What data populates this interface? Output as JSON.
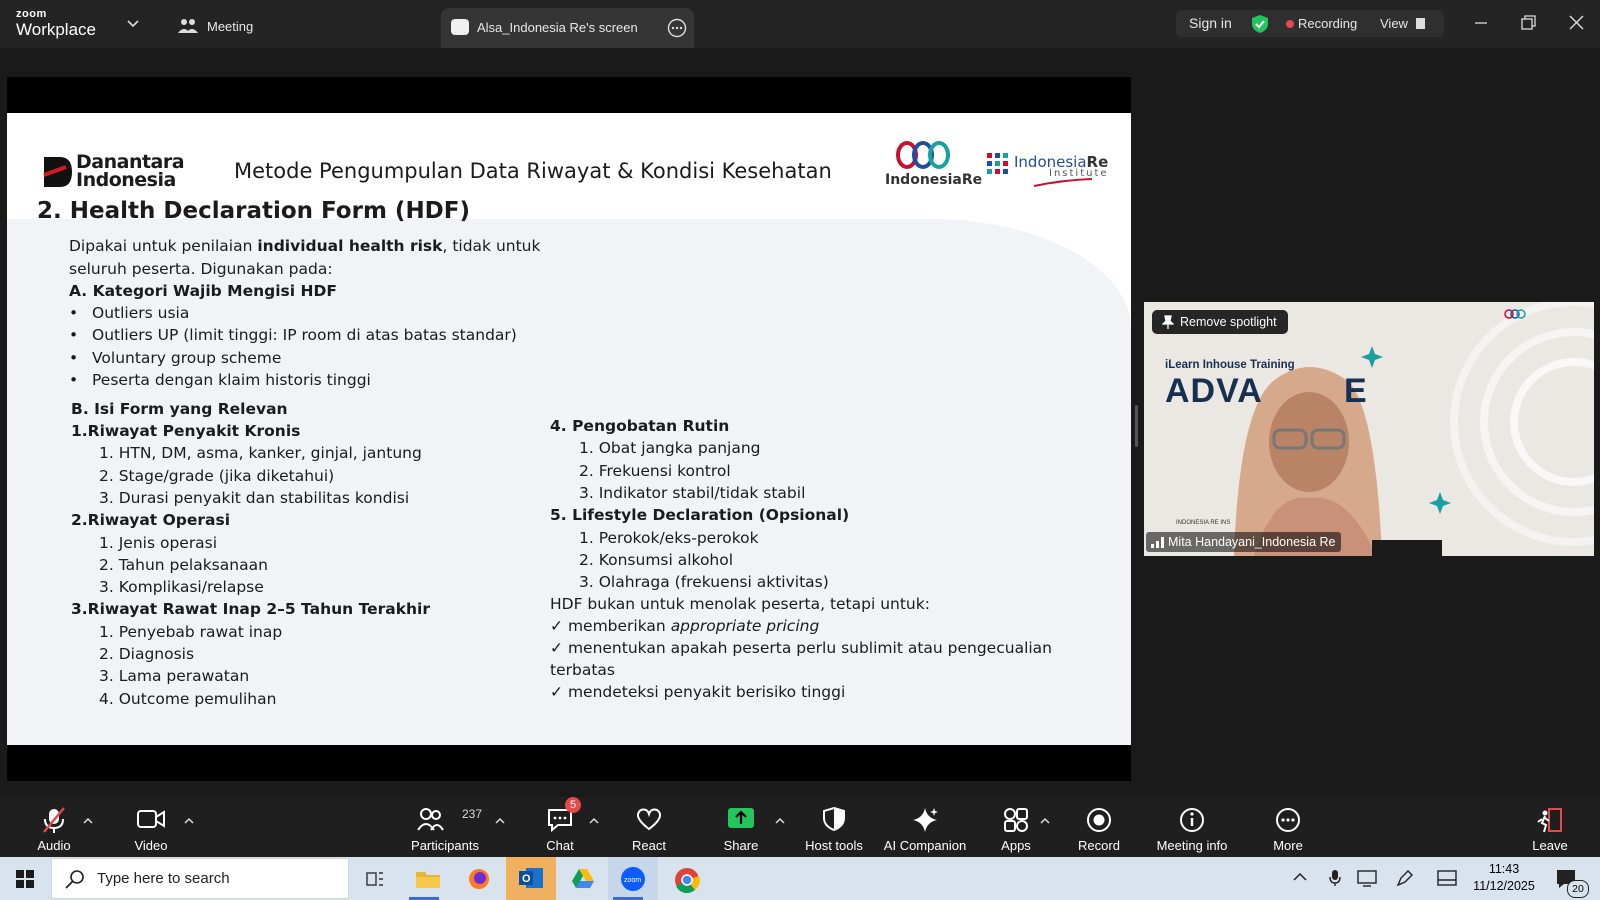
{
  "topbar": {
    "brand_small": "zoom",
    "brand_large": "Workplace",
    "meeting_label": "Meeting",
    "screen_tab": "Alsa_Indonesia Re's screen",
    "sign_in": "Sign in",
    "recording": "Recording",
    "view": "View",
    "colors": {
      "bg": "#242424",
      "shield": "#22c55e",
      "rec": "#e5484d"
    }
  },
  "slide": {
    "logo_left_line1": "Danantara",
    "logo_left_line2": "Indonesia",
    "header_title": "Metode Pengumpulan Data Riwayat & Kondisi Kesehatan",
    "logo_mid_text": "IndonesiaRe",
    "logo_right_text1": "Indonesia",
    "logo_right_text2": "Re",
    "logo_right_sub": "Institute",
    "section_title": "2.  Health Declaration Form (HDF)",
    "intro_pre": "Dipakai untuk penilaian ",
    "intro_bold": "individual health risk",
    "intro_post": ", tidak untuk",
    "intro_line2": "seluruh peserta. Digunakan pada:",
    "cat_a_title": "A. Kategori Wajib Mengisi HDF",
    "cat_a_items": [
      "Outliers usia",
      "Outliers UP (limit tinggi: IP room di atas batas standar)",
      "Voluntary group scheme",
      "Peserta dengan klaim historis tinggi"
    ],
    "bullet": "•",
    "cat_b_title": "B. Isi Form yang Relevan",
    "left_groups": [
      {
        "title": "1.Riwayat Penyakit Kronis",
        "items": [
          "1. HTN, DM, asma, kanker, ginjal, jantung",
          "2. Stage/grade (jika diketahui)",
          "3. Durasi penyakit dan stabilitas kondisi"
        ]
      },
      {
        "title": "2.Riwayat Operasi",
        "items": [
          "1. Jenis operasi",
          "2. Tahun pelaksanaan",
          "3. Komplikasi/relapse"
        ]
      },
      {
        "title": "3.Riwayat Rawat Inap 2–5 Tahun Terakhir",
        "items": [
          "1. Penyebab rawat inap",
          "2. Diagnosis",
          "3. Lama perawatan",
          "4. Outcome pemulihan"
        ]
      }
    ],
    "right_groups": [
      {
        "title": "4. Pengobatan Rutin",
        "items": [
          "1. Obat jangka panjang",
          "2. Frekuensi kontrol",
          "3. Indikator stabil/tidak stabil"
        ]
      },
      {
        "title": "5. Lifestyle Declaration (Opsional)",
        "items": [
          "1. Perokok/eks-perokok",
          "2. Konsumsi alkohol",
          "3. Olahraga (frekuensi aktivitas)"
        ]
      }
    ],
    "hdf_note": "HDF bukan untuk menolak peserta, tetapi untuk:",
    "check": "✓",
    "check1_pre": "memberikan ",
    "check1_italic": "appropriate pricing",
    "check2_line1": "menentukan apakah peserta perlu sublimit atau pengecualian",
    "check2_line2": "terbatas",
    "check3": "mendeteksi penyakit berisiko tinggi"
  },
  "video": {
    "remove_spotlight": "Remove spotlight",
    "bg_caption": "iLearn Inhouse Training",
    "bg_big": "ADVA",
    "bg_big_end": "E",
    "participant_name": "Mita Handayani_Indonesia Re",
    "small_tag": "INDONESIA RE INS"
  },
  "toolbar": {
    "audio": "Audio",
    "video": "Video",
    "participants": "Participants",
    "participants_count": "237",
    "chat": "Chat",
    "chat_badge": "5",
    "react": "React",
    "share": "Share",
    "host_tools": "Host tools",
    "ai_companion": "AI Companion",
    "apps": "Apps",
    "record": "Record",
    "meeting_info": "Meeting info",
    "more": "More",
    "leave": "Leave",
    "colors": {
      "share": "#22c55e",
      "badge": "#e5484d",
      "leave": "#e5484d"
    }
  },
  "taskbar": {
    "search_placeholder": "Type here to search",
    "time": "11:43",
    "date": "11/12/2025",
    "notif_count": "20"
  }
}
